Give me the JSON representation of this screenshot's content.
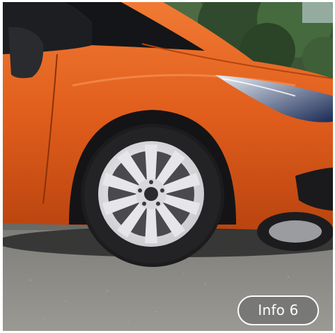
{
  "gallery": {
    "image_subject": "orange-car-front-wheel",
    "info_button": {
      "label": "Info 6"
    }
  },
  "colors": {
    "car_body": "#e2601e",
    "wheel": "#e8e8ea",
    "tire": "#1c1c1e",
    "road": "#8b8a86",
    "foliage": "#2f4a2c",
    "button_bg": "#6e6e6e",
    "button_text": "#ffffff"
  }
}
